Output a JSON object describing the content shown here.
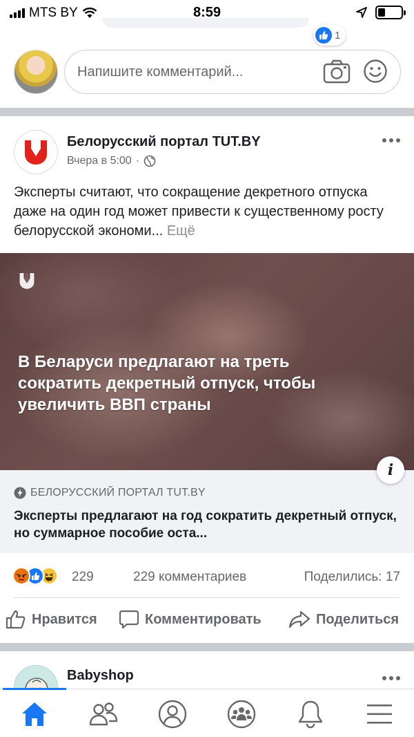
{
  "status_bar": {
    "carrier": "MTS BY",
    "time": "8:59",
    "battery_level": 0.3
  },
  "previous_comment": {
    "reaction_count": "1"
  },
  "composer": {
    "placeholder": "Напишите комментарий..."
  },
  "post": {
    "page_name": "Белорусский портал TUT.BY",
    "timestamp": "Вчера в 5:00",
    "meta_separator": "·",
    "text": "Эксперты считают, что сокращение декретного отпуска даже на один год может привести к существенному росту белорусской экономи...",
    "more_label": "Ещё",
    "link": {
      "image_headline": "В Беларуси предлагают на треть сократить декретный отпуск, чтобы увеличить ВВП страны",
      "info_label": "i",
      "source": "БЕЛОРУССКИЙ ПОРТАЛ TUT.BY",
      "title": "Эксперты предлагают на год сократить декретный отпуск, но суммарное пособие оста..."
    },
    "reactions": {
      "icons": [
        "angry-icon",
        "like-icon",
        "haha-icon"
      ],
      "count": "229"
    },
    "comments_count": "229 комментариев",
    "shares_count": "Поделились: 17",
    "actions": {
      "like": "Нравится",
      "comment": "Комментировать",
      "share": "Поделиться"
    }
  },
  "next_post": {
    "page_name": "Babyshop"
  },
  "tabbar": {
    "tabs": [
      "home-icon",
      "friends-icon",
      "profile-icon",
      "groups-icon",
      "notifications-icon",
      "menu-icon"
    ],
    "active": "home-icon"
  },
  "colors": {
    "brand_blue": "#1877f2",
    "tutby_red": "#e2231a",
    "secondary_text": "#65676b",
    "separator": "#c9ccd1"
  }
}
